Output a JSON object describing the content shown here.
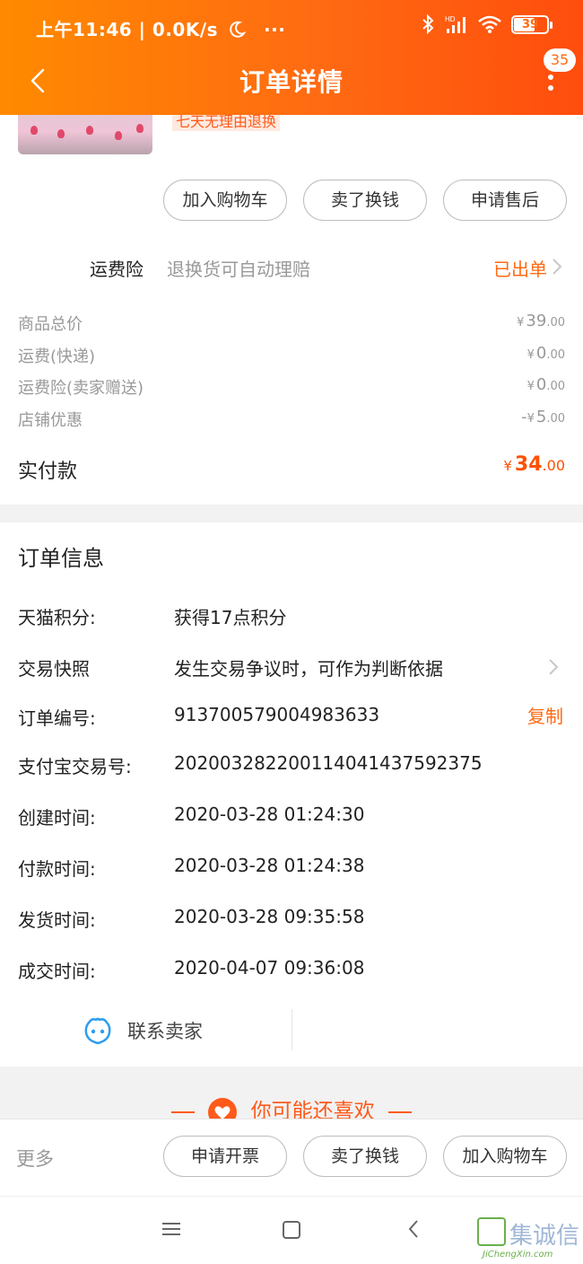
{
  "status_bar": {
    "time": "上午11:46",
    "network_speed": "0.0K/s",
    "dots": "···",
    "network_type": "HD",
    "battery": "39"
  },
  "nav": {
    "title": "订单详情",
    "badge_count": "35"
  },
  "product": {
    "return_tag": "七天无理由退换"
  },
  "item_actions": [
    "加入购物车",
    "卖了换钱",
    "申请售后"
  ],
  "insurance": {
    "title": "运费险",
    "desc": "退换货可自动理赔",
    "status": "已出单"
  },
  "fees": [
    {
      "label": "商品总价",
      "prefix": "",
      "currency": "¥",
      "int": "39",
      "dec": ".00"
    },
    {
      "label": "运费(快递)",
      "prefix": "",
      "currency": "¥",
      "int": "0",
      "dec": ".00"
    },
    {
      "label": "运费险(卖家赠送)",
      "prefix": "",
      "currency": "¥",
      "int": "0",
      "dec": ".00"
    },
    {
      "label": "店铺优惠",
      "prefix": "-",
      "currency": "¥",
      "int": "5",
      "dec": ".00"
    }
  ],
  "paid": {
    "label": "实付款",
    "currency": "¥",
    "int": "34",
    "dec": ".00"
  },
  "order_info": {
    "title": "订单信息",
    "rows": [
      {
        "label": "天猫积分:",
        "value": "获得17点积分"
      },
      {
        "label": "交易快照",
        "value": "发生交易争议时，可作为判断依据"
      },
      {
        "label": "订单编号:",
        "value": "913700579004983633"
      },
      {
        "label": "支付宝交易号:",
        "value": "2020032822001140414375923­75"
      },
      {
        "label": "创建时间:",
        "value": "2020-03-28 01:24:30"
      },
      {
        "label": "付款时间:",
        "value": "2020-03-28 01:24:38"
      },
      {
        "label": "发货时间:",
        "value": "2020-03-28 09:35:58"
      },
      {
        "label": "成交时间:",
        "value": "2020-04-07 09:36:08"
      }
    ],
    "copy_label": "复制"
  },
  "contact": {
    "label": "联系卖家"
  },
  "recommend": {
    "title": "你可能还喜欢"
  },
  "bottom_bar": {
    "more": "更多",
    "actions": [
      "申请开票",
      "卖了换钱",
      "加入购物车"
    ]
  },
  "watermark": {
    "text": "集诚信",
    "subtext": "JiChengXin.com"
  },
  "colors": {
    "accent": "#ff6a12",
    "price": "#ff5000",
    "header_start": "#ff8a00",
    "header_end": "#ff4d0d"
  }
}
